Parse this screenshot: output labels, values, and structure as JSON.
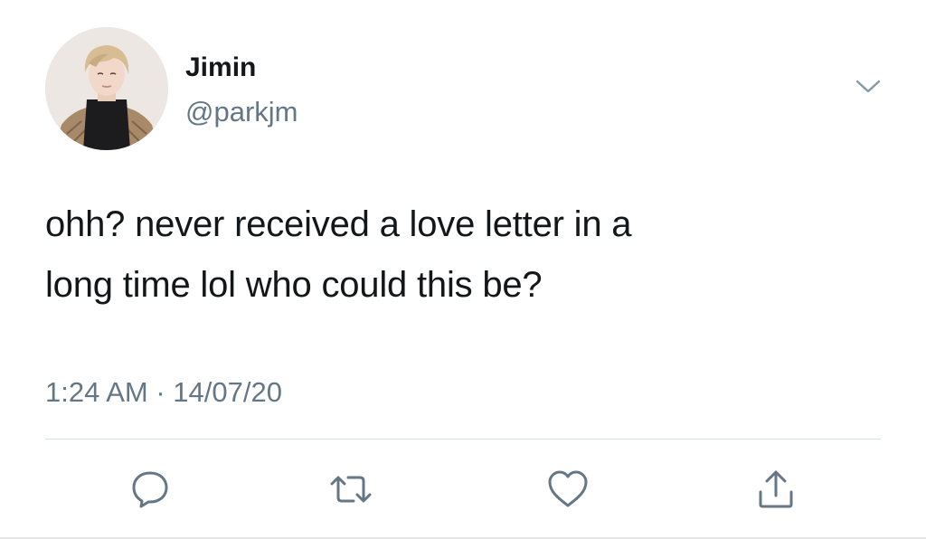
{
  "user": {
    "display_name": "Jimin",
    "handle": "@parkjm",
    "avatar_icon": "profile-photo"
  },
  "tweet": {
    "text_line1": "ohh? never received a love letter in a",
    "text_line2": "long time lol who could this be?",
    "timestamp": "1:24 AM · 14/07/20"
  },
  "actions": {
    "reply_icon": "reply-icon",
    "retweet_icon": "retweet-icon",
    "like_icon": "heart-icon",
    "share_icon": "share-icon",
    "menu_icon": "chevron-down-icon"
  },
  "colors": {
    "text": "#14171a",
    "secondary": "#657786",
    "divider": "#d8dde2"
  }
}
